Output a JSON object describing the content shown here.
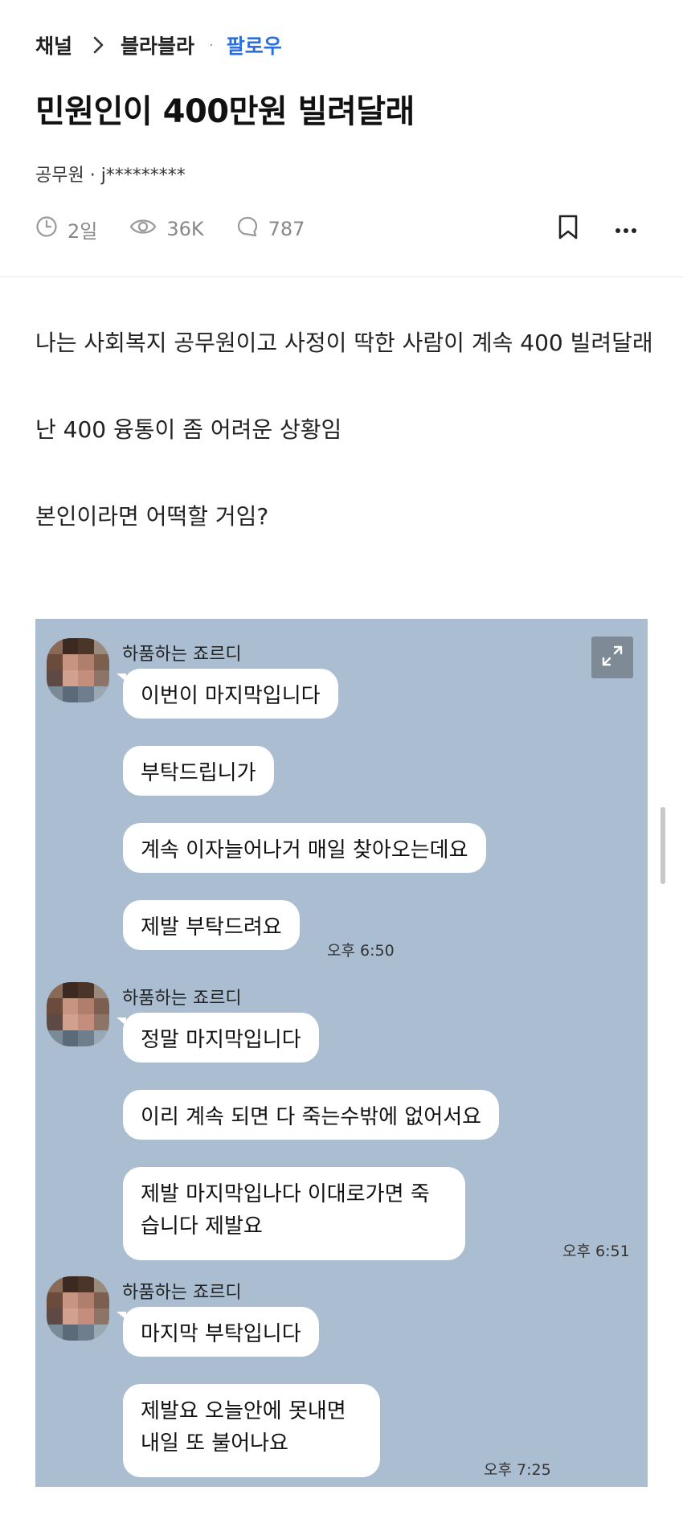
{
  "breadcrumb": {
    "channel": "채널",
    "board": "블라블라",
    "separator": "·",
    "follow": "팔로우"
  },
  "post": {
    "title": "민원인이 400만원 빌려달래",
    "author_line": "공무원 · j*********",
    "time_ago": "2일",
    "views": "36K",
    "comments": "787",
    "body": [
      "나는 사회복지 공무원이고 사정이 딱한 사람이 계속 400 빌려달래",
      "난 400 융통이 좀 어려운 상황임",
      "본인이라면 어떡할 거임?"
    ]
  },
  "chat": {
    "groups": [
      {
        "sender": "하품하는 죠르디",
        "messages": [
          "이번이 마지막입니다",
          "부탁드립니가",
          "계속 이자늘어나거 매일 찾아오는데요",
          "제발 부탁드려요"
        ],
        "time": "오후 6:50"
      },
      {
        "sender": "하품하는 죠르디",
        "messages": [
          "정말 마지막입니다",
          "이리 계속 되면 다 죽는수밖에 없어서요",
          "제발 마지막입나다 이대로가면 죽습니다 제발요"
        ],
        "time": "오후 6:51"
      },
      {
        "sender": "하품하는 죠르디",
        "messages": [
          "마지막 부탁입니다",
          "제발요 오늘안에 못내면 내일 또 불어나요"
        ],
        "time": "오후 7:25"
      }
    ]
  },
  "icons": {
    "clock": "clock-icon",
    "eye": "eye-icon",
    "comment": "comment-icon",
    "bookmark": "bookmark-icon",
    "more": "more-icon",
    "expand": "expand-icon",
    "chevron": "chevron-right-icon"
  },
  "colors": {
    "accent": "#2a6fdb",
    "chat_bg": "#aabdd1",
    "meta": "#888888"
  }
}
